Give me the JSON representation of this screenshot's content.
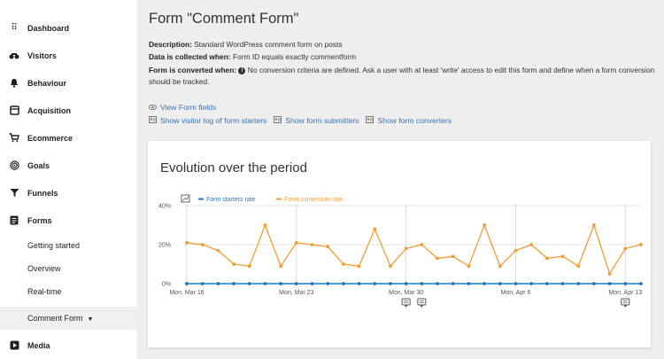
{
  "sidebar": {
    "items": [
      {
        "label": "Dashboard",
        "icon": "dashboard-icon",
        "glyph": "⠿"
      },
      {
        "label": "Visitors",
        "icon": "visitors-icon",
        "glyph": "👓"
      },
      {
        "label": "Behaviour",
        "icon": "bell-icon",
        "glyph": "🔔"
      },
      {
        "label": "Acquisition",
        "icon": "acquisition-icon",
        "glyph": "▣"
      },
      {
        "label": "Ecommerce",
        "icon": "cart-icon",
        "glyph": "🛒"
      },
      {
        "label": "Goals",
        "icon": "target-icon",
        "glyph": "◎"
      },
      {
        "label": "Funnels",
        "icon": "funnel-icon",
        "glyph": "▼"
      },
      {
        "label": "Forms",
        "icon": "forms-icon",
        "glyph": "▤"
      }
    ],
    "subitems": [
      {
        "label": "Getting started"
      },
      {
        "label": "Overview"
      },
      {
        "label": "Real-time"
      },
      {
        "label": "Comment Form"
      }
    ],
    "media": {
      "label": "Media",
      "icon": "media-icon",
      "glyph": "▶"
    }
  },
  "page": {
    "title": "Form \"Comment Form\"",
    "description_label": "Description:",
    "description_value": " Standard WordPress comment form on posts",
    "collected_label": "Data is collected when:",
    "collected_value": " Form ID equals exactly commentform",
    "converted_label": "Form is converted when:",
    "converted_value": " No conversion criteria are defined. Ask a user with at least 'write' access to edit this form and define when a form conversion should be tracked.",
    "view_fields": "View Form fields",
    "links": [
      "Show visitor log of form starters",
      "Show form submitters",
      "Show form converters"
    ]
  },
  "chart_card": {
    "title": "Evolution over the period"
  },
  "chart_data": {
    "type": "line",
    "title": "Evolution over the period",
    "y_ticks": [
      "40%",
      "20%",
      "0%"
    ],
    "ylim": [
      0,
      40
    ],
    "x_tick_labels": [
      "Mon, Mar 16",
      "Mon, Mar 23",
      "Mon, Mar 30",
      "Mon, Apr 6",
      "Mon, Apr 13"
    ],
    "x": [
      "Mar 16",
      "Mar 17",
      "Mar 18",
      "Mar 19",
      "Mar 20",
      "Mar 21",
      "Mar 22",
      "Mar 23",
      "Mar 24",
      "Mar 25",
      "Mar 26",
      "Mar 27",
      "Mar 28",
      "Mar 29",
      "Mar 30",
      "Mar 31",
      "Apr 1",
      "Apr 2",
      "Apr 3",
      "Apr 4",
      "Apr 5",
      "Apr 6",
      "Apr 7",
      "Apr 8",
      "Apr 9",
      "Apr 10",
      "Apr 11",
      "Apr 12",
      "Apr 13",
      "Apr 14"
    ],
    "series": [
      {
        "name": "Form starters rate",
        "color": "#1f78c1",
        "values": [
          0,
          0,
          0,
          0,
          0,
          0,
          0,
          0,
          0,
          0,
          0,
          0,
          0,
          0,
          0,
          0,
          0,
          0,
          0,
          0,
          0,
          0,
          0,
          0,
          0,
          0,
          0,
          0,
          0,
          0
        ]
      },
      {
        "name": "Form conversion rate",
        "color": "#f09d36",
        "values": [
          21,
          20,
          17,
          10,
          9,
          30,
          9,
          21,
          20,
          19,
          10,
          9,
          28,
          9,
          18,
          20,
          13,
          14,
          9,
          30,
          9,
          17,
          20,
          13,
          14,
          9,
          30,
          5,
          18,
          20
        ]
      }
    ],
    "annotation_days": [
      "Mar 30",
      "Mar 31",
      "Apr 13"
    ],
    "grid": true,
    "legend": "top-left"
  }
}
